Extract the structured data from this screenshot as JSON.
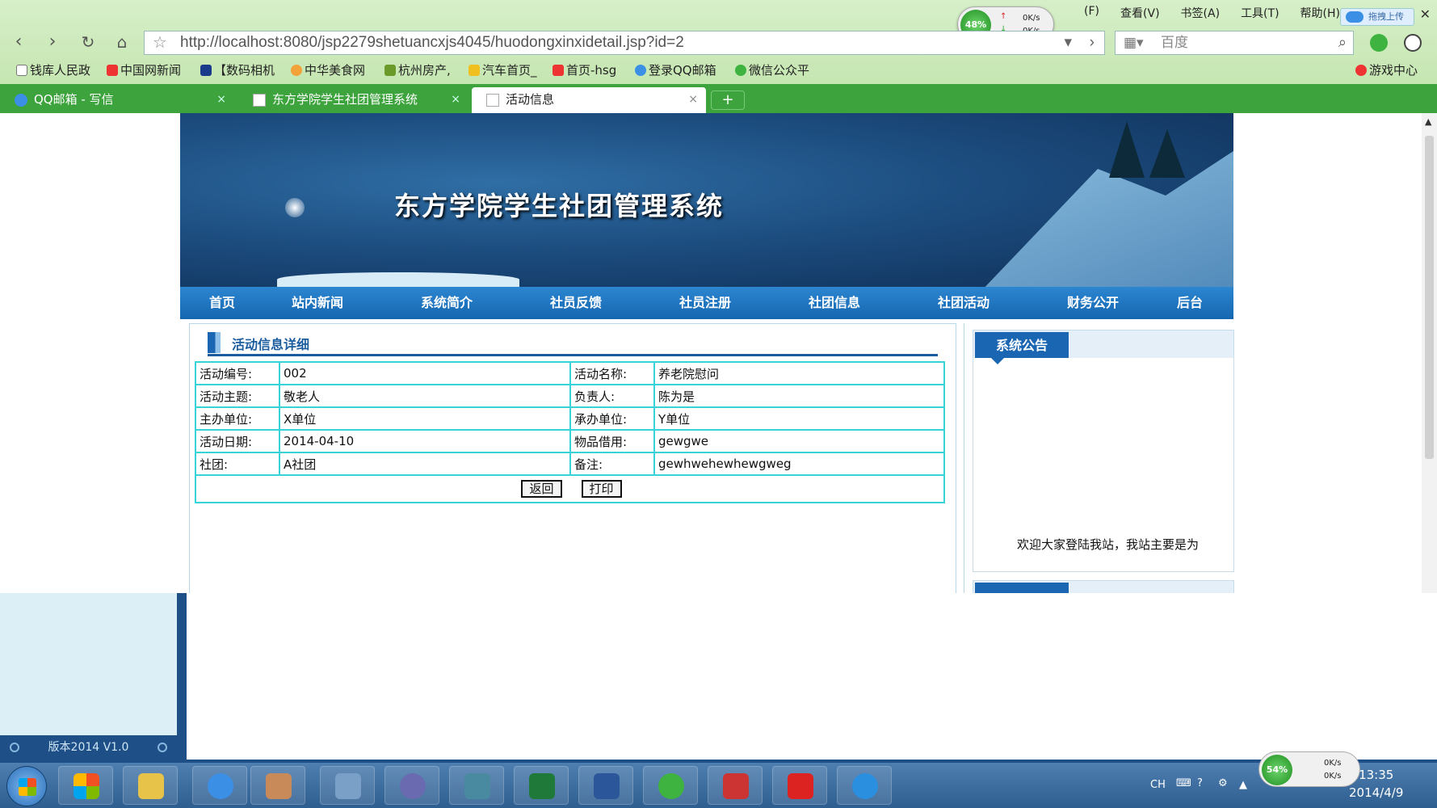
{
  "browser": {
    "menu": [
      "(F)",
      "查看(V)",
      "书签(A)",
      "工具(T)",
      "帮助(H)"
    ],
    "net_widget": {
      "percent": "48%",
      "up": "0K/s",
      "down": "0K/s"
    },
    "upload_label": "拖拽上传",
    "url_prefix": "http://",
    "url_host": "localhost",
    "url_rest": ":8080/jsp2279shetuancxjs4045/huodongxinxidetail.jsp?id=2",
    "search_placeholder": "百度",
    "bookmarks": [
      "钱库人民政",
      "中国网新闻",
      "【数码相机",
      "中华美食网",
      "杭州房产,",
      "汽车首页_",
      "首页-hsg",
      "登录QQ邮箱",
      "微信公众平",
      "游戏中心"
    ],
    "tabs": [
      {
        "label": "QQ邮箱 - 写信"
      },
      {
        "label": "东方学院学生社团管理系统"
      },
      {
        "label": "活动信息"
      }
    ],
    "new_tab_label": "+"
  },
  "site": {
    "title": "东方学院学生社团管理系统",
    "nav": [
      "首页",
      "站内新闻",
      "系统简介",
      "社员反馈",
      "社员注册",
      "社团信息",
      "社团活动",
      "财务公开",
      "后台"
    ],
    "section_title": "活动信息详细",
    "rows": [
      {
        "l1": "活动编号:",
        "v1": "002",
        "l2": "活动名称:",
        "v2": "养老院慰问"
      },
      {
        "l1": "活动主题:",
        "v1": "敬老人",
        "l2": "负责人:",
        "v2": "陈为是"
      },
      {
        "l1": "主办单位:",
        "v1": "X单位",
        "l2": "承办单位:",
        "v2": "Y单位"
      },
      {
        "l1": "活动日期:",
        "v1": "2014-04-10",
        "l2": "物品借用:",
        "v2": "gewgwe"
      },
      {
        "l1": "社团:",
        "v1": "A社团",
        "l2": "备注:",
        "v2": "gewhwehewhewgweg"
      }
    ],
    "back_button": "返回",
    "print_button": "打印",
    "notice_title": "系统公告",
    "notice_text": "欢迎大家登陆我站，我站主要是为"
  },
  "desktop": {
    "version": "版本2014 V1.0"
  },
  "taskbar": {
    "lang": "CH",
    "net_widget": {
      "percent": "54%",
      "up": "0K/s",
      "down": "0K/s"
    },
    "time": "13:35",
    "date": "2014/4/9"
  },
  "colors": {
    "tab_bar": "#3da33d",
    "nav_blue": "#1566b0",
    "table_border": "#36d3d8"
  }
}
